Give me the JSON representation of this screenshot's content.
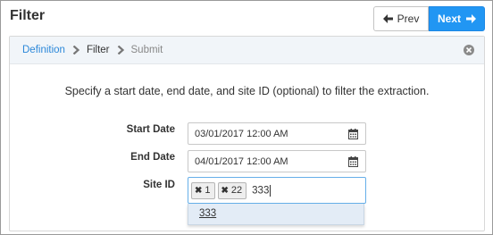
{
  "header": {
    "title": "Filter",
    "prev_label": "Prev",
    "next_label": "Next"
  },
  "breadcrumb": {
    "items": [
      {
        "label": "Definition",
        "state": "link"
      },
      {
        "label": "Filter",
        "state": "current"
      },
      {
        "label": "Submit",
        "state": "future"
      }
    ]
  },
  "form": {
    "instruction": "Specify a start date, end date, and site ID (optional) to filter the extraction.",
    "start_date": {
      "label": "Start Date",
      "value": "03/01/2017 12:00 AM"
    },
    "end_date": {
      "label": "End Date",
      "value": "04/01/2017 12:00 AM"
    },
    "site_id": {
      "label": "Site ID",
      "tags": [
        "1",
        "22"
      ],
      "input_value": "333",
      "suggestions": [
        "333"
      ]
    }
  },
  "icons": {
    "prev": "arrow-left-icon",
    "next": "arrow-right-icon",
    "close": "close-circle-icon",
    "calendar": "calendar-icon",
    "tag_remove": "times-icon",
    "breadcrumb_separator": "chevron-right-icon"
  },
  "colors": {
    "primary": "#2196f3",
    "link": "#2c88d9",
    "panel_header": "#f1f5f9",
    "focus_border": "#66afe9",
    "suggestion_bg": "#e3ecf6"
  }
}
